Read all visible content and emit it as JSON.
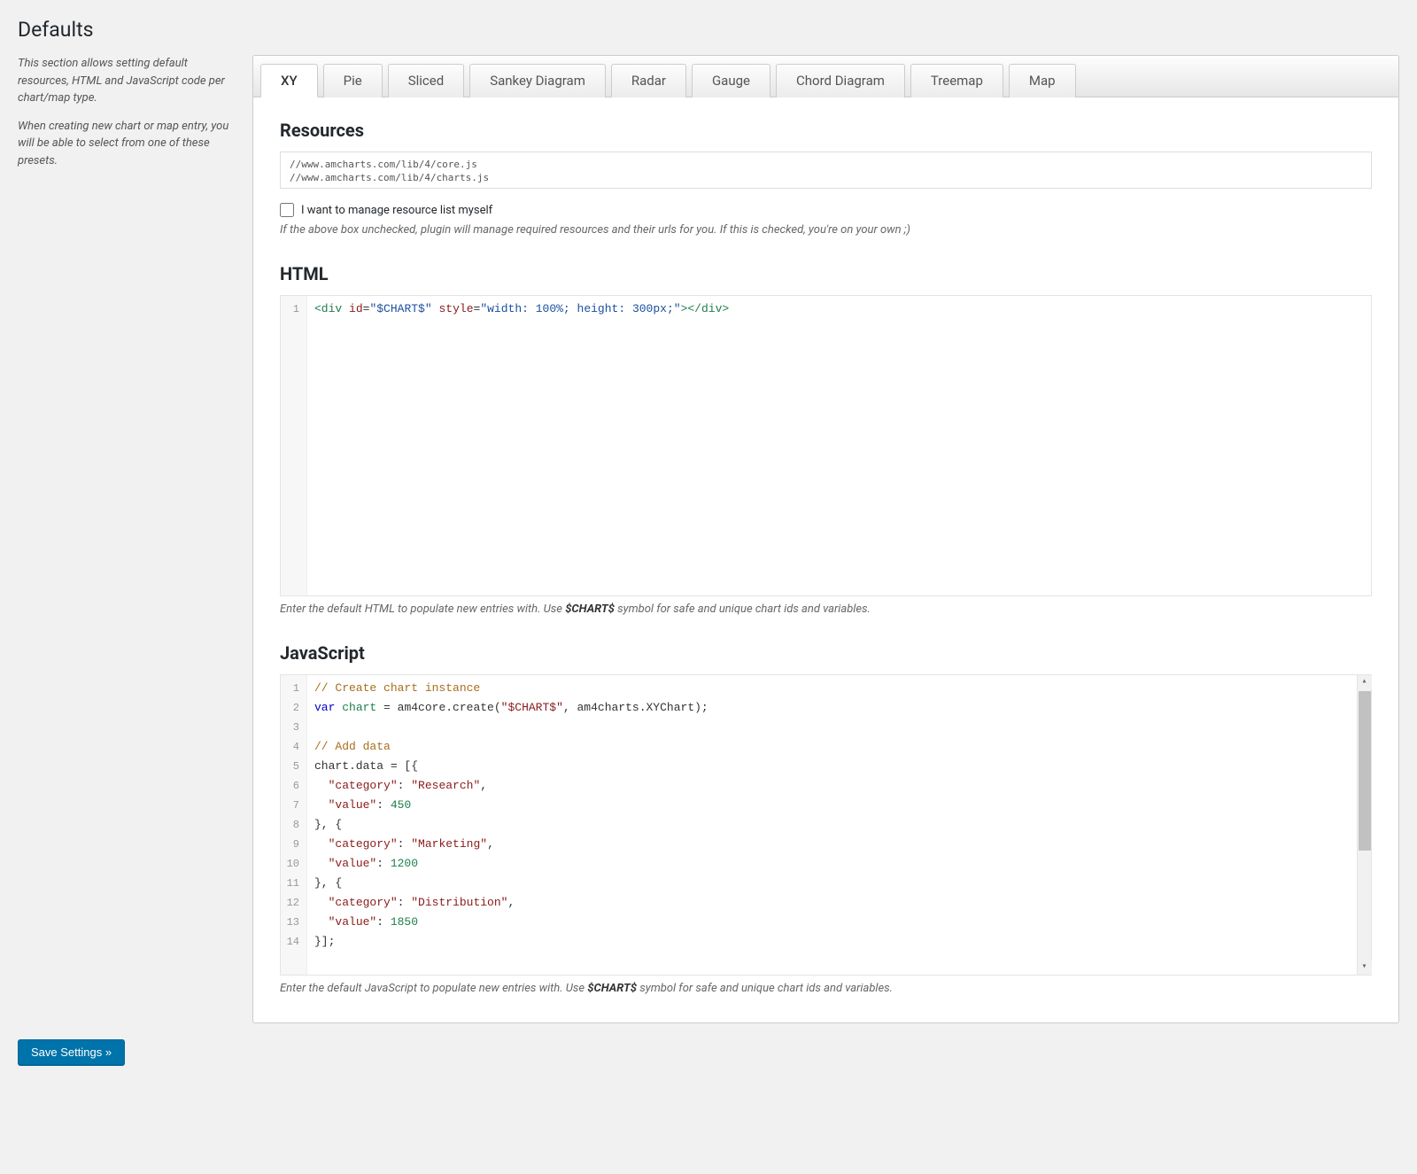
{
  "page": {
    "title": "Defaults"
  },
  "sidebar": {
    "intro1": "This section allows setting default resources, HTML and JavaScript code per chart/map type.",
    "intro2": "When creating new chart or map entry, you will be able to select from one of these presets."
  },
  "tabs": [
    {
      "label": "XY",
      "active": true
    },
    {
      "label": "Pie"
    },
    {
      "label": "Sliced"
    },
    {
      "label": "Sankey Diagram"
    },
    {
      "label": "Radar"
    },
    {
      "label": "Gauge"
    },
    {
      "label": "Chord Diagram"
    },
    {
      "label": "Treemap"
    },
    {
      "label": "Map"
    }
  ],
  "sections": {
    "resources": {
      "heading": "Resources",
      "value": "//www.amcharts.com/lib/4/core.js\n//www.amcharts.com/lib/4/charts.js",
      "checkbox_label": "I want to manage resource list myself",
      "hint": "If the above box unchecked, plugin will manage required resources and their urls for you. If this is checked, you're on your own ;)"
    },
    "html": {
      "heading": "HTML",
      "hint_pre": "Enter the default HTML to populate new entries with. Use ",
      "hint_symbol": "$CHART$",
      "hint_post": " symbol for safe and unique chart ids and variables.",
      "code_lines": [
        {
          "n": 1,
          "html": "<span class='tok-tag'>&lt;div</span> <span class='tok-attr'>id</span>=<span class='tok-str'>\"$CHART$\"</span> <span class='tok-attr'>style</span>=<span class='tok-str'>\"width: 100%; height: 300px;\"</span><span class='tok-tag'>&gt;&lt;/div&gt;</span>"
        }
      ]
    },
    "js": {
      "heading": "JavaScript",
      "hint_pre": "Enter the default JavaScript to populate new entries with. Use ",
      "hint_symbol": "$CHART$",
      "hint_post": " symbol for safe and unique chart ids and variables.",
      "code_lines": [
        {
          "n": 1,
          "html": "<span class='tok-cmt'>// Create chart instance</span>"
        },
        {
          "n": 2,
          "html": "<span class='tok-kw'>var</span> <span class='tok-var'>chart</span> = am4core.create(<span class='tok-prop'>\"$CHART$\"</span>, am4charts.XYChart);"
        },
        {
          "n": 3,
          "html": ""
        },
        {
          "n": 4,
          "html": "<span class='tok-cmt'>// Add data</span>"
        },
        {
          "n": 5,
          "html": "chart.data = [{"
        },
        {
          "n": 6,
          "html": "  <span class='tok-prop'>\"category\"</span>: <span class='tok-prop'>\"Research\"</span>,"
        },
        {
          "n": 7,
          "html": "  <span class='tok-prop'>\"value\"</span>: <span class='tok-num'>450</span>"
        },
        {
          "n": 8,
          "html": "}, {"
        },
        {
          "n": 9,
          "html": "  <span class='tok-prop'>\"category\"</span>: <span class='tok-prop'>\"Marketing\"</span>,"
        },
        {
          "n": 10,
          "html": "  <span class='tok-prop'>\"value\"</span>: <span class='tok-num'>1200</span>"
        },
        {
          "n": 11,
          "html": "}, {"
        },
        {
          "n": 12,
          "html": "  <span class='tok-prop'>\"category\"</span>: <span class='tok-prop'>\"Distribution\"</span>,"
        },
        {
          "n": 13,
          "html": "  <span class='tok-prop'>\"value\"</span>: <span class='tok-num'>1850</span>"
        },
        {
          "n": 14,
          "html": "}];"
        }
      ]
    }
  },
  "save_button": "Save Settings »"
}
